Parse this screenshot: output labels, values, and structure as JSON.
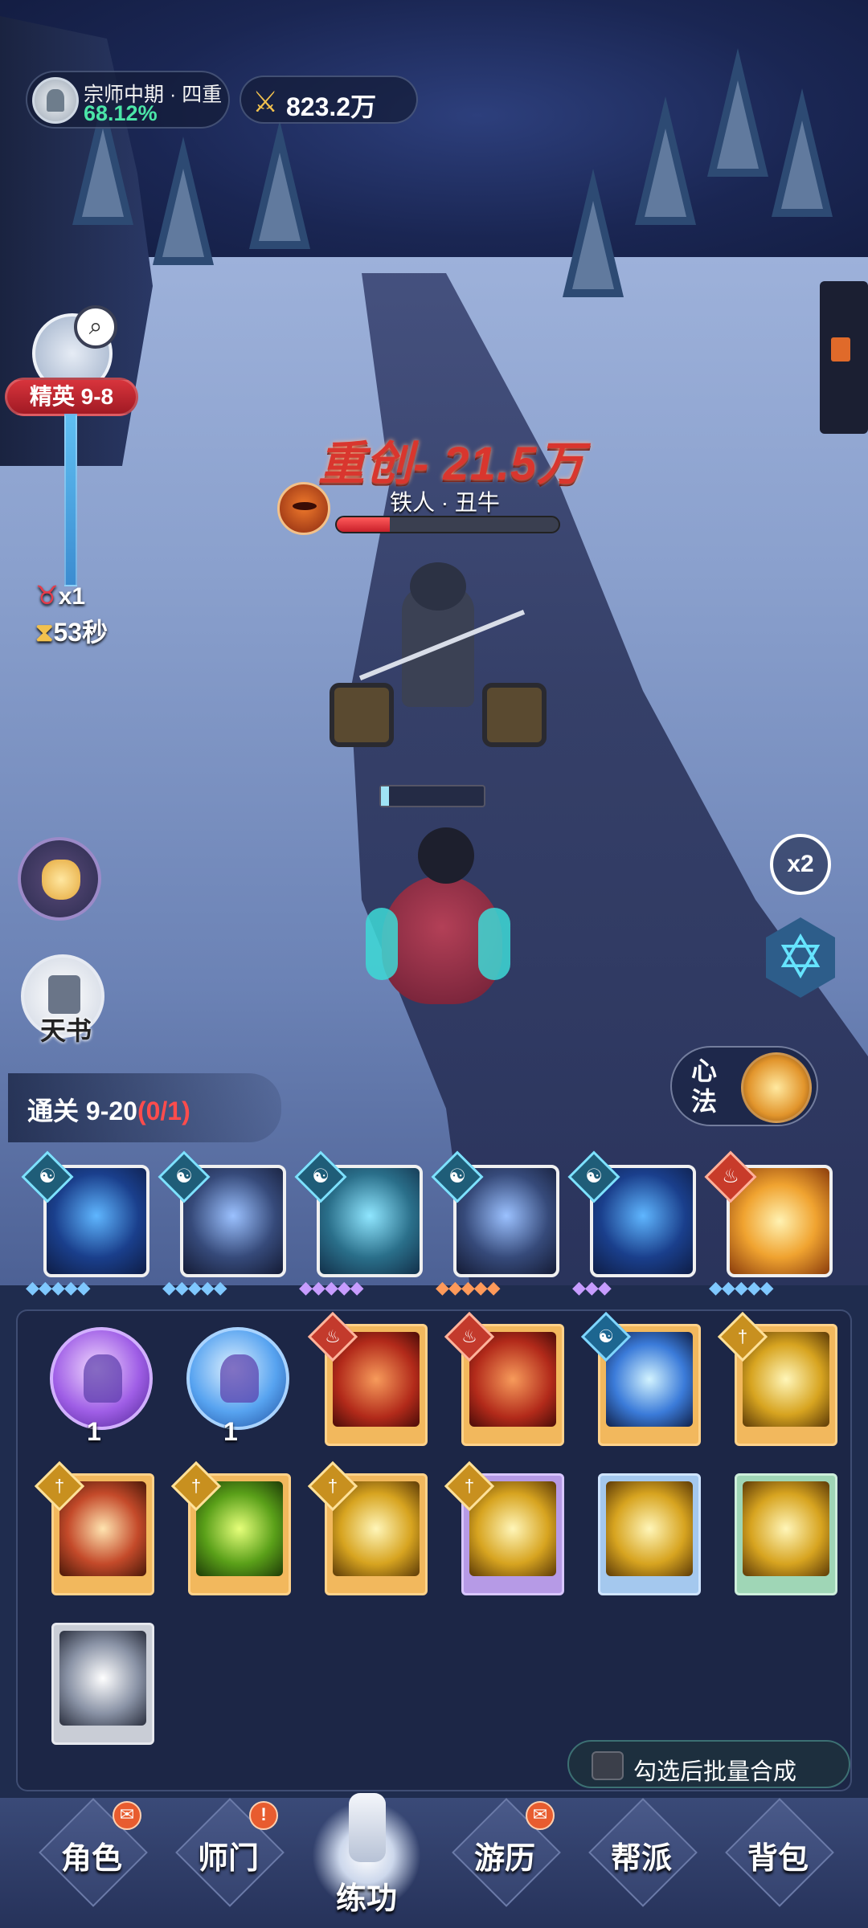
{
  "player": {
    "rank": "宗师中期 · 四重",
    "progress": "68.12%",
    "power": "823.2万"
  },
  "stage": {
    "badge": "精英 9-8",
    "multiplier": "x1",
    "timer": "53秒"
  },
  "boss": {
    "damage_text": "重创- 21.5万",
    "name": "铁人 · 丑牛",
    "hp_fraction": 0.24
  },
  "side": {
    "book_label": "天书",
    "speed_label": "x2",
    "xinfa_label": "心法"
  },
  "quest": {
    "label": "通关 9-20",
    "progress": "(0/1)"
  },
  "skills": [
    {
      "element": "water",
      "element_glyph": "☯",
      "stars": "◆◆◆◆◆",
      "star_color": "#7fc8ff",
      "art": "blue"
    },
    {
      "element": "water",
      "element_glyph": "☯",
      "stars": "◆◆◆◆◆",
      "star_color": "#7fc8ff",
      "art": "dark"
    },
    {
      "element": "water",
      "element_glyph": "☯",
      "stars": "◆◆◆◆◆",
      "star_color": "#c79cff",
      "art": "teal"
    },
    {
      "element": "water",
      "element_glyph": "☯",
      "stars": "◆◆◆◆◆",
      "star_color": "#ff9a5a",
      "art": "dark"
    },
    {
      "element": "water",
      "element_glyph": "☯",
      "stars": "◆◆◆",
      "star_color": "#c79cff",
      "art": "blue"
    },
    {
      "element": "fire",
      "element_glyph": "♨",
      "stars": "◆◆◆◆◆",
      "star_color": "#7fc8ff",
      "art": "gold"
    }
  ],
  "inventory": {
    "orbs": [
      {
        "color": "purple",
        "count": "1"
      },
      {
        "color": "blue",
        "count": "1"
      }
    ],
    "books": [
      {
        "cover": "orange",
        "art": "red",
        "badge": "fire",
        "glyph": "♨"
      },
      {
        "cover": "orange",
        "art": "red",
        "badge": "fire",
        "glyph": "♨"
      },
      {
        "cover": "orange",
        "art": "cyan",
        "badge": "water",
        "glyph": "☯"
      },
      {
        "cover": "orange",
        "art": "lightning",
        "badge": "metal",
        "glyph": "†"
      },
      {
        "cover": "orange",
        "art": "swords",
        "badge": "metal",
        "glyph": "†"
      },
      {
        "cover": "orange",
        "art": "green",
        "badge": "metal",
        "glyph": "†"
      },
      {
        "cover": "orange",
        "art": "lightning",
        "badge": "metal",
        "glyph": "†"
      },
      {
        "cover": "purple",
        "art": "lightning",
        "badge": "metal",
        "glyph": "†"
      },
      {
        "cover": "blue",
        "art": "lightning",
        "badge": "none",
        "glyph": ""
      },
      {
        "cover": "green",
        "art": "lightning",
        "badge": "none",
        "glyph": ""
      },
      {
        "cover": "gray",
        "art": "hand",
        "badge": "none",
        "glyph": ""
      }
    ],
    "batch_label": "勾选后批量合成"
  },
  "nav": {
    "items": [
      {
        "label": "角色",
        "badge": "✉"
      },
      {
        "label": "师门",
        "badge": "!"
      },
      {
        "label": "练功",
        "badge": ""
      },
      {
        "label": "游历",
        "badge": "✉"
      },
      {
        "label": "帮派",
        "badge": ""
      },
      {
        "label": "背包",
        "badge": ""
      }
    ]
  },
  "colors": {
    "progress_green": "#4be6a8",
    "stage_red": "#d8343c",
    "quest_progress_red": "#ff4c4c",
    "damage_red": "#d9362e"
  }
}
